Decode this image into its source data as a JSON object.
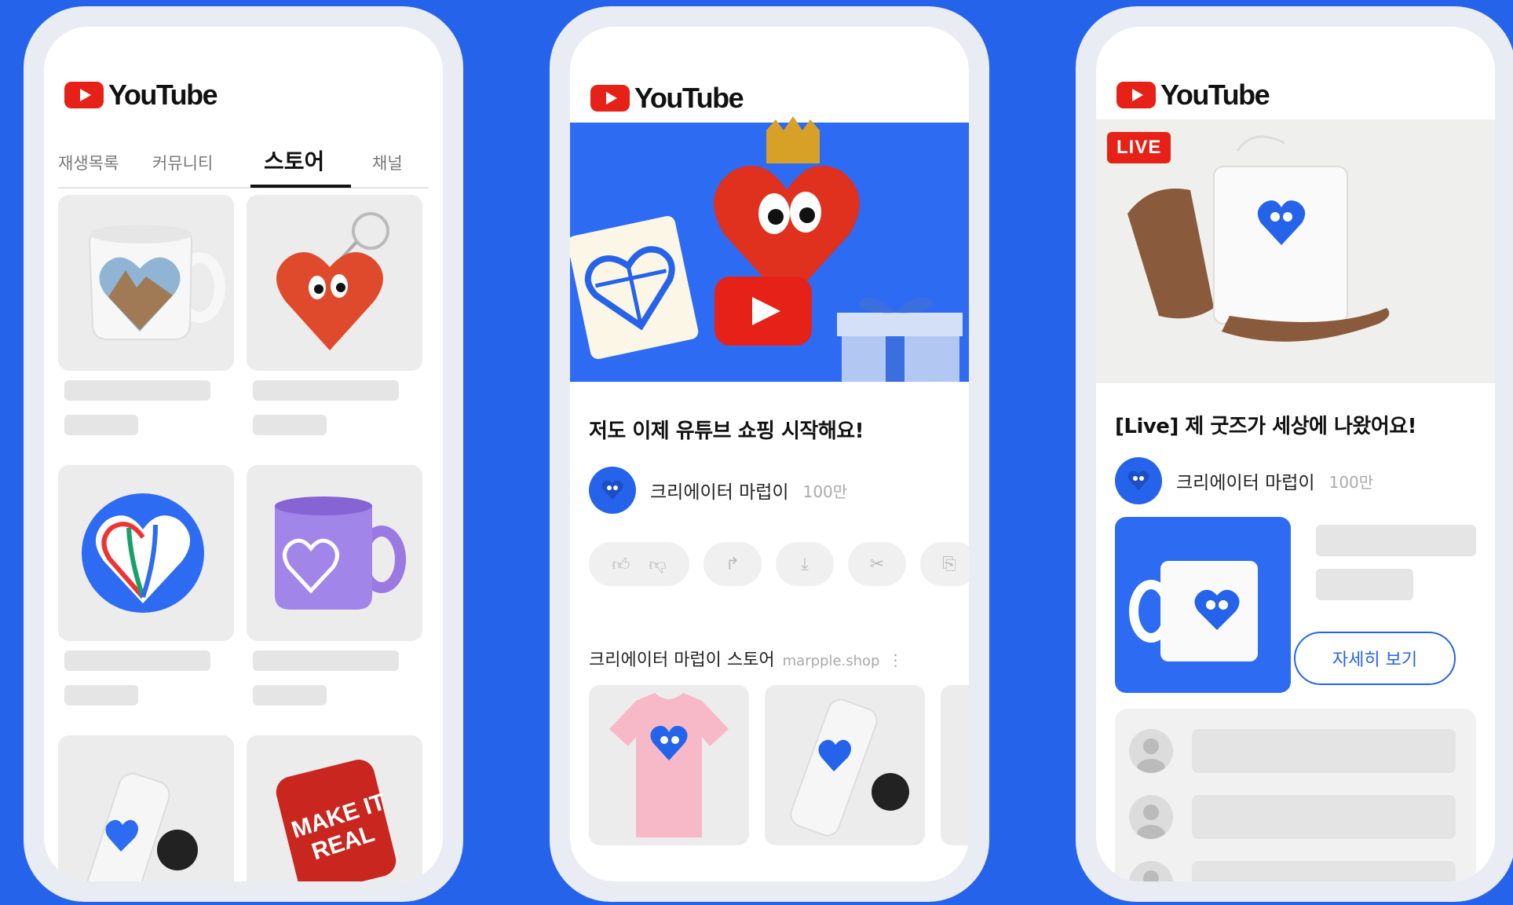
{
  "brand": {
    "logo_text": "YouTube",
    "accent": "#e62117",
    "background": "#2563eb"
  },
  "phone1": {
    "tabs": [
      {
        "label": "재생목록"
      },
      {
        "label": "커뮤니티"
      },
      {
        "label": "스토어",
        "active": true
      },
      {
        "label": "채널"
      }
    ],
    "products": [
      {
        "name": "heart-photo-mug",
        "icon": "mug-icon"
      },
      {
        "name": "heart-keychain",
        "icon": "keychain-icon"
      },
      {
        "name": "heart-globe-sticker",
        "icon": "sticker-icon"
      },
      {
        "name": "purple-mug",
        "icon": "mug-icon"
      },
      {
        "name": "white-tumbler",
        "icon": "tumbler-icon"
      },
      {
        "name": "make-it-real-pillow",
        "icon": "pillow-icon",
        "print": "MAKE IT REAL"
      }
    ]
  },
  "phone2": {
    "video_title": "저도 이제 유튜브 쇼핑 시작해요!",
    "channel": {
      "name": "크리에이터 마럽이",
      "subs": "100만"
    },
    "store": {
      "title": "크리에이터 마럽이 스토어",
      "url": "marpple.shop"
    },
    "actions": [
      "like-dislike",
      "share",
      "download",
      "clip",
      "save"
    ]
  },
  "phone3": {
    "live_badge": "LIVE",
    "video_title": "[Live] 제 굿즈가 세상에 나왔어요!",
    "channel": {
      "name": "크리에이터 마럽이",
      "subs": "100만"
    },
    "detail_button": "자세히 보기"
  }
}
